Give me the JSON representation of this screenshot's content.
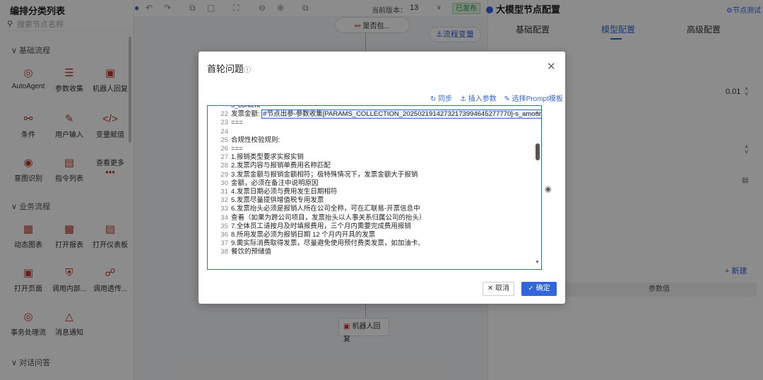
{
  "sidebar": {
    "title": "编排分类列表",
    "search_placeholder": "搜索节点名称",
    "sections": [
      "基础流程",
      "业务流程",
      "对话问答"
    ],
    "basic_items": [
      {
        "label": "AutoAgent",
        "icon": "target-icon"
      },
      {
        "label": "参数收集",
        "icon": "sliders-icon"
      },
      {
        "label": "机器人回复",
        "icon": "robot-icon"
      },
      {
        "label": "条件",
        "icon": "branch-icon"
      },
      {
        "label": "用户输入",
        "icon": "edit-icon"
      },
      {
        "label": "变量赋值",
        "icon": "code-icon"
      },
      {
        "label": "意图识别",
        "icon": "bulb-icon"
      },
      {
        "label": "指令列表",
        "icon": "list-icon"
      },
      {
        "label": "查看更多",
        "icon": "more-icon"
      }
    ],
    "business_items": [
      {
        "label": "动态图表",
        "icon": "chart-icon"
      },
      {
        "label": "打开报表",
        "icon": "report-icon"
      },
      {
        "label": "打开仪表板",
        "icon": "dashboard-icon"
      },
      {
        "label": "打开页面",
        "icon": "page-icon"
      },
      {
        "label": "调用内部...",
        "icon": "shield-icon"
      },
      {
        "label": "调用透传...",
        "icon": "link-icon"
      },
      {
        "label": "事务处理流",
        "icon": "flow-icon"
      },
      {
        "label": "消息通知",
        "icon": "bell-icon"
      }
    ]
  },
  "toolbar": {
    "version_label": "当前版本：",
    "version_value": "13",
    "status": "已发布"
  },
  "canvas": {
    "node_top": "是否包...",
    "node_bottom": "机器人回复",
    "flow_var": "流程变量"
  },
  "right_panel": {
    "title": "大模型节点配置",
    "test_link": "节点测试",
    "tabs": [
      "基础配置",
      "模型配置",
      "高级配置"
    ],
    "value_temp": "0.01",
    "new_link": "+ 新建",
    "param_header": "参数值"
  },
  "dialog": {
    "title": "首轮问题",
    "actions": [
      "同步",
      "插入参数",
      "选择Prompt模板"
    ],
    "cancel": "取消",
    "ok": "确定",
    "lines": [
      {
        "n": "",
        "t": "s_content"
      },
      {
        "n": "22",
        "t": "发票金额:",
        "hl": "#节点出参-参数收集[PARAMS_COLLECTION_20250219142732173994645277770]-s_amount"
      },
      {
        "n": "23",
        "t": "==="
      },
      {
        "n": "24",
        "t": ""
      },
      {
        "n": "25",
        "t": "合规性校验规则:"
      },
      {
        "n": "26",
        "t": "==="
      },
      {
        "n": "27",
        "t": "1.报销类型要求实报实销"
      },
      {
        "n": "28",
        "t": "2.发票内容与报销单费用名称匹配"
      },
      {
        "n": "29",
        "t": "3.发票金额与报销金额相符；极特殊情况下，发票金额大于报销"
      },
      {
        "n": "30",
        "t": "金额，必须在备注中说明原因"
      },
      {
        "n": "31",
        "t": "4.发票日期必须与费用发生日期相符"
      },
      {
        "n": "32",
        "t": "5.发票尽量提供增值税专用发票"
      },
      {
        "n": "33",
        "t": "6.发票抬头必须是报销人所在公司全称，可在汇联易-开票信息中"
      },
      {
        "n": "34",
        "t": "查看（如果为跨公司项目，发票抬头以人事关系归属公司的抬头）"
      },
      {
        "n": "35",
        "t": "7.全体员工请按月及时填报费用，三个月内需要完成费用报销"
      },
      {
        "n": "36",
        "t": "8.所用发票必须为报销日期 12 个月内开具的发票"
      },
      {
        "n": "37",
        "t": "9.需实际消费取得发票，尽量避免使用预付费类发票，如加油卡、"
      },
      {
        "n": "38",
        "t": "餐饮的预储值"
      }
    ]
  }
}
